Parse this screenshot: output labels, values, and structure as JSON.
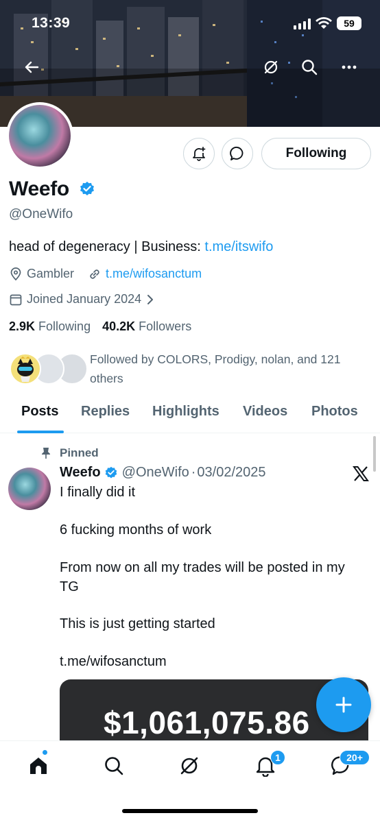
{
  "status_bar": {
    "time": "13:39",
    "battery": "59"
  },
  "profile": {
    "name": "Weefo",
    "handle": "@OneWifo",
    "bio_prefix": "head of degeneracy | Business: ",
    "bio_link": "t.me/itswifo",
    "location": "Gambler",
    "website": "t.me/wifosanctum",
    "joined": "Joined January 2024",
    "following_count": "2.9K",
    "following_label": "Following",
    "followers_count": "40.2K",
    "followers_label": "Followers",
    "followed_by_line1": "Followed by COLORS, Prodigy, nolan, and 121",
    "followed_by_line2": "others",
    "follow_button": "Following"
  },
  "tabs": [
    {
      "label": "Posts",
      "active": true
    },
    {
      "label": "Replies",
      "active": false
    },
    {
      "label": "Highlights",
      "active": false
    },
    {
      "label": "Videos",
      "active": false
    },
    {
      "label": "Photos",
      "active": false
    }
  ],
  "post": {
    "pinned_label": "Pinned",
    "author": "Weefo",
    "handle": "@OneWifo",
    "separator": "·",
    "date": "03/02/2025",
    "lines": [
      "I finally did it",
      "6 fucking months of work",
      "From now on all my trades will be posted in my",
      "TG",
      "This is just getting started"
    ],
    "link": "t.me/wifosanctum",
    "card_amount": "$1,061,075.86"
  },
  "bottom_nav": {
    "notifications_badge": "1",
    "messages_badge": "20+"
  },
  "colors": {
    "accent": "#1d9bf0",
    "text": "#0f1419",
    "muted": "#536471"
  }
}
